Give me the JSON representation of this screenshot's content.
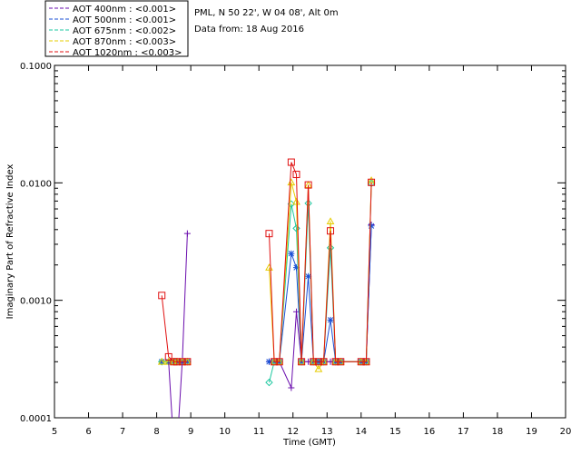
{
  "header": {
    "station": "PML, N 50 22', W 04 08', Alt 0m",
    "data_from": "Data from: 18 Aug 2016"
  },
  "chart_data": {
    "type": "line",
    "title": "",
    "xlabel": "Time (GMT)",
    "ylabel": "Imaginary Part of Refractive Index",
    "xlim": [
      5,
      20
    ],
    "ylim": [
      0.0001,
      0.1
    ],
    "yscale": "log",
    "x_ticks": [
      "5",
      "6",
      "7",
      "8",
      "9",
      "10",
      "11",
      "12",
      "13",
      "14",
      "15",
      "16",
      "17",
      "18",
      "19",
      "20"
    ],
    "y_ticks": [
      "0.0001",
      "0.0010",
      "0.0100",
      "0.1000"
    ],
    "legend_position": "top-left (above plot)",
    "series": [
      {
        "name": "AOT  400nm : <0.001>",
        "color": "#6a0dad",
        "marker": "plus",
        "points": [
          [
            8.15,
            0.0003
          ],
          [
            8.35,
            0.0003
          ],
          [
            8.5,
            0.0003
          ],
          [
            8.6,
            0.0003
          ],
          [
            8.75,
            0.0003
          ],
          [
            8.9,
            0.0037
          ],
          [
            11.3,
            0.0003
          ],
          [
            11.45,
            0.0003
          ],
          [
            11.6,
            0.0003
          ],
          [
            11.95,
            0.00018
          ],
          [
            12.1,
            0.0008
          ],
          [
            12.25,
            0.0003
          ],
          [
            12.45,
            0.0003
          ],
          [
            12.6,
            0.0003
          ],
          [
            12.75,
            0.0003
          ],
          [
            12.9,
            0.0003
          ],
          [
            13.1,
            0.0003
          ],
          [
            13.25,
            0.0003
          ],
          [
            13.4,
            0.0003
          ],
          [
            14.0,
            0.0003
          ],
          [
            14.15,
            0.0003
          ],
          [
            14.3,
            0.0044
          ]
        ]
      },
      {
        "name": "AOT  500nm : <0.001>",
        "color": "#1a4fd6",
        "marker": "star",
        "points": [
          [
            8.15,
            0.0003
          ],
          [
            8.35,
            0.0003
          ],
          [
            8.5,
            0.0003
          ],
          [
            8.6,
            0.0003
          ],
          [
            8.75,
            0.0003
          ],
          [
            8.9,
            0.0003
          ],
          [
            11.3,
            0.0003
          ],
          [
            11.45,
            0.0003
          ],
          [
            11.6,
            0.0003
          ],
          [
            11.95,
            0.0025
          ],
          [
            12.1,
            0.0019
          ],
          [
            12.25,
            0.0003
          ],
          [
            12.45,
            0.0016
          ],
          [
            12.6,
            0.0003
          ],
          [
            12.75,
            0.0003
          ],
          [
            12.9,
            0.0003
          ],
          [
            13.1,
            0.00068
          ],
          [
            13.25,
            0.0003
          ],
          [
            13.4,
            0.0003
          ],
          [
            14.0,
            0.0003
          ],
          [
            14.15,
            0.0003
          ],
          [
            14.3,
            0.0043
          ]
        ]
      },
      {
        "name": "AOT  675nm : <0.002>",
        "color": "#1ec8a0",
        "marker": "diamond",
        "points": [
          [
            8.15,
            0.0003
          ],
          [
            8.35,
            0.0003
          ],
          [
            8.5,
            0.0003
          ],
          [
            8.6,
            0.0003
          ],
          [
            8.75,
            0.0003
          ],
          [
            8.9,
            0.0003
          ],
          [
            11.3,
            0.0002
          ],
          [
            11.45,
            0.0003
          ],
          [
            11.6,
            0.0003
          ],
          [
            11.95,
            0.0066
          ],
          [
            12.1,
            0.0041
          ],
          [
            12.25,
            0.0003
          ],
          [
            12.45,
            0.0067
          ],
          [
            12.6,
            0.0003
          ],
          [
            12.75,
            0.0003
          ],
          [
            12.9,
            0.0003
          ],
          [
            13.1,
            0.0028
          ],
          [
            13.25,
            0.0003
          ],
          [
            13.4,
            0.0003
          ],
          [
            14.0,
            0.0003
          ],
          [
            14.15,
            0.0003
          ],
          [
            14.3,
            0.0099
          ]
        ]
      },
      {
        "name": "AOT  870nm : <0.003>",
        "color": "#e6cc00",
        "marker": "triangle",
        "points": [
          [
            8.15,
            0.0003
          ],
          [
            8.35,
            0.0003
          ],
          [
            8.5,
            0.0003
          ],
          [
            8.6,
            0.0003
          ],
          [
            8.75,
            0.0003
          ],
          [
            8.9,
            0.0003
          ],
          [
            11.3,
            0.0019
          ],
          [
            11.45,
            0.0003
          ],
          [
            11.6,
            0.0003
          ],
          [
            11.95,
            0.0101
          ],
          [
            12.1,
            0.0069
          ],
          [
            12.25,
            0.0003
          ],
          [
            12.45,
            0.0096
          ],
          [
            12.6,
            0.0003
          ],
          [
            12.75,
            0.00026
          ],
          [
            12.9,
            0.0003
          ],
          [
            13.1,
            0.0047
          ],
          [
            13.25,
            0.0003
          ],
          [
            13.4,
            0.0003
          ],
          [
            14.0,
            0.0003
          ],
          [
            14.15,
            0.0003
          ],
          [
            14.3,
            0.0105
          ]
        ]
      },
      {
        "name": "AOT 1020nm : <0.003>",
        "color": "#e01010",
        "marker": "square",
        "points": [
          [
            8.15,
            0.0011
          ],
          [
            8.35,
            0.00033
          ],
          [
            8.5,
            0.0003
          ],
          [
            8.6,
            0.0003
          ],
          [
            8.75,
            0.0003
          ],
          [
            8.9,
            0.0003
          ],
          [
            11.3,
            0.0037
          ],
          [
            11.45,
            0.0003
          ],
          [
            11.6,
            0.0003
          ],
          [
            11.95,
            0.015
          ],
          [
            12.1,
            0.0118
          ],
          [
            12.25,
            0.0003
          ],
          [
            12.45,
            0.0096
          ],
          [
            12.6,
            0.0003
          ],
          [
            12.75,
            0.0003
          ],
          [
            12.9,
            0.0003
          ],
          [
            13.1,
            0.0039
          ],
          [
            13.25,
            0.0003
          ],
          [
            13.4,
            0.0003
          ],
          [
            14.0,
            0.0003
          ],
          [
            14.15,
            0.0003
          ],
          [
            14.3,
            0.0101
          ]
        ]
      }
    ]
  }
}
